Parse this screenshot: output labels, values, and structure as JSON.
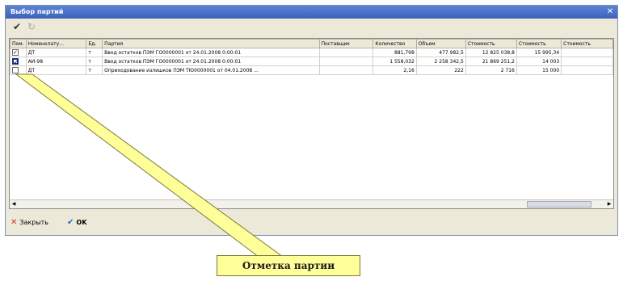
{
  "window": {
    "title": "Выбор партий"
  },
  "toolbar": {
    "check_icon": "check-icon",
    "refresh_icon": "refresh-icon"
  },
  "table": {
    "columns": [
      "Пом.",
      "Номенклату...",
      "Ед.",
      "Партия",
      "Поставщик",
      "Количество",
      "Объем",
      "Стоимость",
      "Стоимость",
      "Стоимость"
    ],
    "rows": [
      {
        "checked": true,
        "cells": [
          "ДТ",
          "т",
          "Ввод остатков ПЭМ ГО0000001 от 24.01.2008 0:00:01",
          "",
          "881,798",
          "477 982,5",
          "12 825 038,8",
          "15 995,34",
          ""
        ]
      },
      {
        "checked": true,
        "cells": [
          "АИ-98",
          "т",
          "Ввод остатков ПЭМ ГО0000001 от 24.01.2008 0:00:01",
          "",
          "1 558,032",
          "2 258 342,5",
          "21 869 251,2",
          "14 003",
          ""
        ]
      },
      {
        "checked": false,
        "cells": [
          "ДТ",
          "т",
          "Оприходование излишков ПЭМ ТЮ0000001 от 04.01.2008 ...",
          "",
          "2,16",
          "222",
          "2 716",
          "15 000",
          ""
        ]
      }
    ]
  },
  "buttons": {
    "close_label": "Закрыть",
    "ok_label": "OK"
  },
  "callout": {
    "label": "Отметка партии"
  }
}
